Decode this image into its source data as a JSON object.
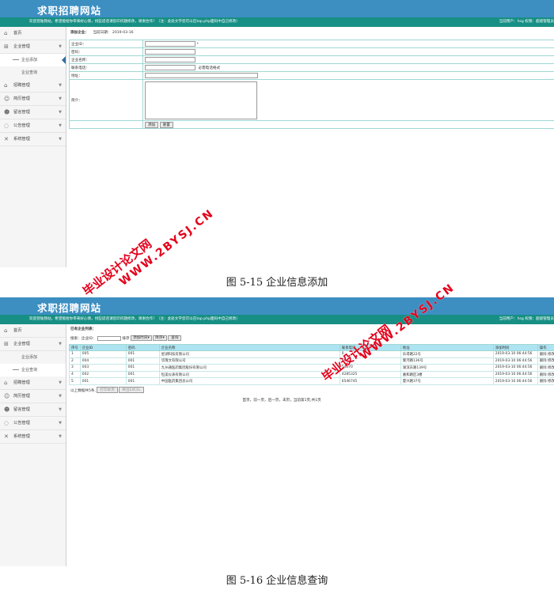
{
  "site_title": "求职招聘网站",
  "welcome_text": "欢迎登陆我站，希望能给你带来好心情，找些适话请您印问题修改，谢谢合作！（注：此处文字您可以在top.php面码中自己修改）",
  "user_info": "当前用户：hsg 权限：超级管理员",
  "sidebar": {
    "home": "首页",
    "company_mgmt": "企业管理",
    "company_add": "企业添加",
    "company_query": "企业查询",
    "recruit_mgmt": "招聘管理",
    "resume_mgmt": "简历管理",
    "message_mgmt": "留言管理",
    "notice_mgmt": "公告管理",
    "system_mgmt": "系统管理"
  },
  "icons": {
    "home": "home-icon",
    "company": "grid-icon",
    "recruit": "home-icon",
    "resume": "user-icon",
    "message": "user-icon",
    "notice": "chat-icon",
    "system": "tools-icon",
    "chevron": "chevron-down-icon"
  },
  "colors": {
    "topbar": "#3d8fc2",
    "infobar": "#178f84",
    "table_border": "#9fd7d3",
    "table_header": "#aee3f1",
    "watermark": "#e4001b"
  },
  "add_form": {
    "breadcrumb_label": "添加企业：",
    "date_label": "当前日期：",
    "date_value": "2019-03-16",
    "fields": {
      "company_id": "企业ID：",
      "password": "密码：",
      "company_name": "企业名称：",
      "phone": "联系电话：",
      "phone_hint": "必需电话格式",
      "address": "地址：",
      "intro": "简介："
    },
    "required_mark": "*",
    "submit": "添加",
    "reset": "重置"
  },
  "caption_1": "图 5-15 企业信息添加",
  "list": {
    "title": "已有企业列表：",
    "search_label": "搜索：企业ID：",
    "sort_label": "排序",
    "sort_field": "添加时间",
    "sort_order": "降序",
    "search_button": "查询",
    "columns": [
      "序号",
      "企业ID",
      "密码",
      "企业名称",
      "联系电话",
      "地址",
      "添加时间",
      "操作"
    ],
    "rows": [
      [
        "1",
        "005",
        "001",
        "星湖科技有限公司",
        "0",
        "乐得路22号",
        "2019-03-10 06:44:56",
        "删除 修改"
      ],
      [
        "2",
        "004",
        "001",
        "华隆文有限公司",
        "0",
        "隆河路136号",
        "2019-03-10 06:44:56",
        "删除 修改"
      ],
      [
        "3",
        "003",
        "001",
        "九州通医药集团股份有限公司",
        "54070",
        "湖滨东路139号",
        "2019-03-10 06:44:56",
        "删除 修改"
      ],
      [
        "4",
        "002",
        "001",
        "恒美仪表有限公司",
        "4285325",
        "嘉和路区3楼",
        "2019-03-10 06:44:56",
        "删除 修改"
      ],
      [
        "5",
        "001",
        "001",
        "中国医药集团总公司",
        "6546745",
        "夏兴路37号",
        "2019-03-10 06:44:56",
        "删除 修改"
      ]
    ],
    "total_text": "以上数据共5条,",
    "print_button": "打印本页",
    "export_button": "导出EXCEL",
    "pagination": "首页，前一页，后一页，末页，当前第1页,共1页"
  },
  "caption_2": "图 5-16 企业信息查询",
  "watermarks": {
    "cn": "毕业设计论文网",
    "url": "WWW.2BYSJ.CN"
  }
}
